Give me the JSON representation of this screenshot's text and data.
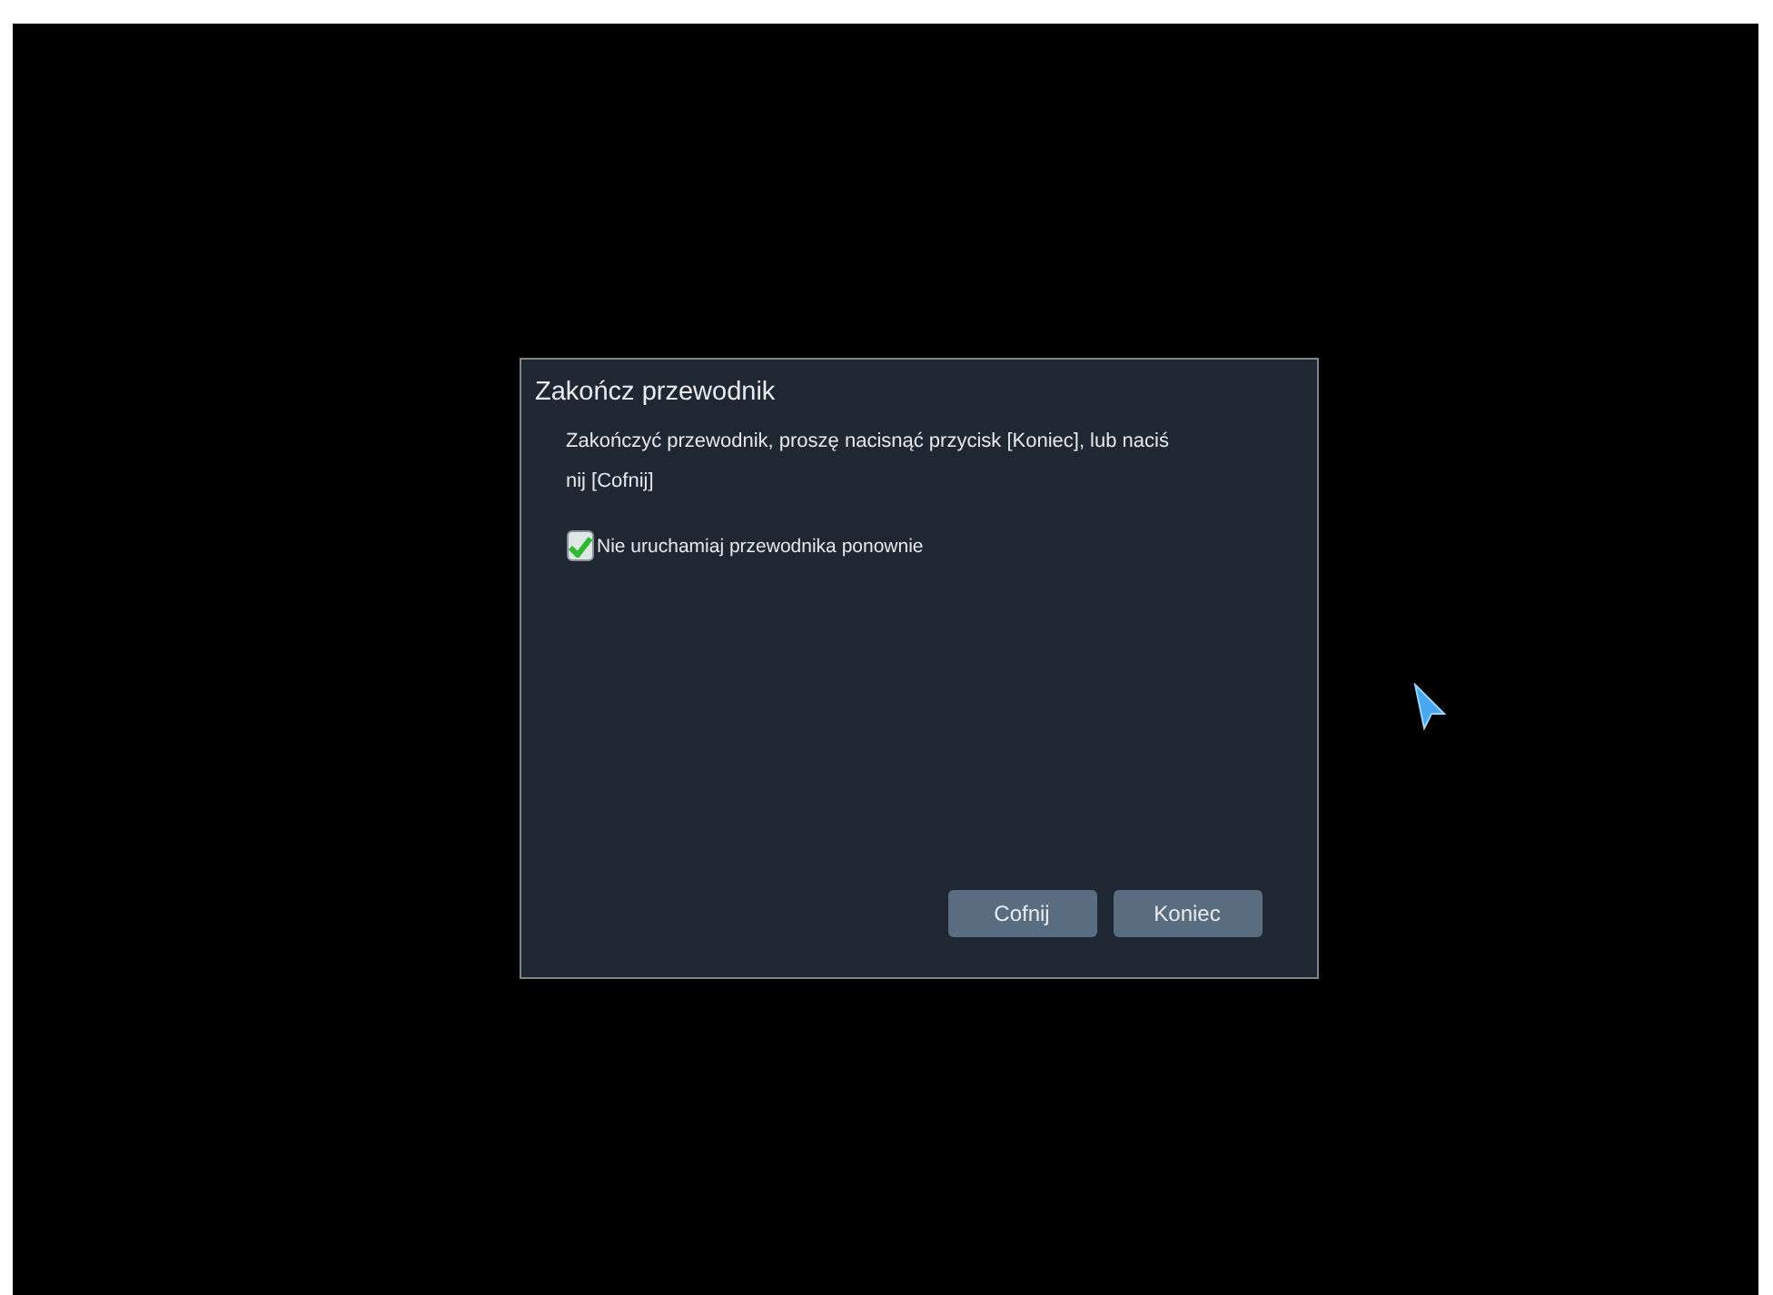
{
  "dialog": {
    "title": "Zakończ przewodnik",
    "message_lines": [
      "Zakończyć przewodnik, proszę nacisnąć przycisk [Koniec], lub naciś",
      "nij [Cofnij]"
    ],
    "checkbox": {
      "label": "Nie uruchamiaj przewodnika ponownie",
      "checked": true
    },
    "buttons": [
      "Cofnij",
      "Koniec"
    ]
  }
}
